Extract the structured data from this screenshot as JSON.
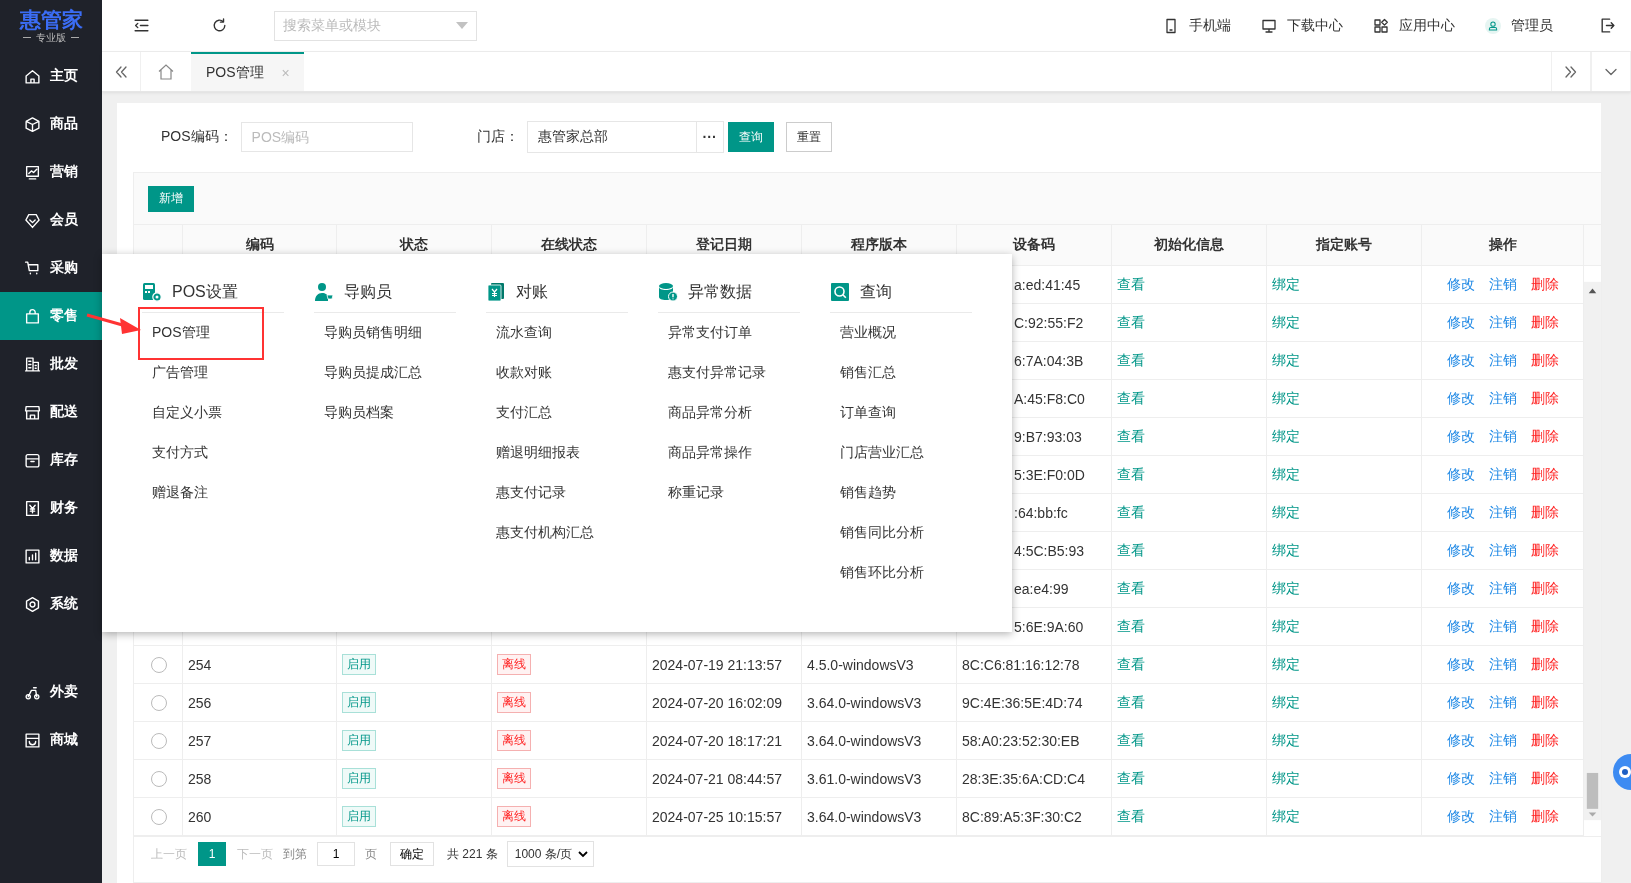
{
  "logo": {
    "name": "惠管家",
    "edition": "专业版"
  },
  "sidebar": {
    "items": [
      {
        "label": "主页",
        "selected": false
      },
      {
        "label": "商品",
        "selected": false
      },
      {
        "label": "营销",
        "selected": false
      },
      {
        "label": "会员",
        "selected": false
      },
      {
        "label": "采购",
        "selected": false
      },
      {
        "label": "零售",
        "selected": true
      },
      {
        "label": "批发",
        "selected": false
      },
      {
        "label": "配送",
        "selected": false
      },
      {
        "label": "库存",
        "selected": false
      },
      {
        "label": "财务",
        "selected": false
      },
      {
        "label": "数据",
        "selected": false
      },
      {
        "label": "系统",
        "selected": false
      }
    ],
    "extra_items": [
      {
        "label": "外卖",
        "selected": false
      },
      {
        "label": "商城",
        "selected": false
      }
    ]
  },
  "topbar": {
    "search": {
      "placeholder": "搜索菜单或模块"
    },
    "links": [
      "手机端",
      "下载中心",
      "应用中心"
    ],
    "user": "管理员"
  },
  "tabs": [
    {
      "label": "POS管理",
      "selected": true,
      "close": "×"
    }
  ],
  "filters": {
    "pos_code": {
      "label": "POS编码：",
      "placeholder": "POS编码"
    },
    "store": {
      "label": "门店：",
      "value": "惠管家总部",
      "picker": "···"
    },
    "buttons": [
      {
        "label": "查询",
        "kind": "primary"
      },
      {
        "label": "重置",
        "kind": "default"
      }
    ]
  },
  "add_button": "新增",
  "table": {
    "columns": [
      "编码",
      "状态",
      "在线状态",
      "登记日期",
      "程序版本",
      "设备码",
      "初始化信息",
      "指定账号",
      "操作"
    ],
    "rows": [
      {
        "kind": "covered",
        "device": "a:ed:41:45",
        "init": "查看",
        "account": "绑定",
        "actions": [
          "修改",
          "注销",
          "删除"
        ]
      },
      {
        "kind": "covered",
        "device": "C:92:55:F2",
        "init": "查看",
        "account": "绑定",
        "actions": [
          "修改",
          "注销",
          "删除"
        ]
      },
      {
        "kind": "covered",
        "device": "6:7A:04:3B",
        "init": "查看",
        "account": "绑定",
        "actions": [
          "修改",
          "注销",
          "删除"
        ]
      },
      {
        "kind": "covered",
        "device": "A:45:F8:C0",
        "init": "查看",
        "account": "绑定",
        "actions": [
          "修改",
          "注销",
          "删除"
        ]
      },
      {
        "kind": "covered",
        "device": "9:B7:93:03",
        "init": "查看",
        "account": "绑定",
        "actions": [
          "修改",
          "注销",
          "删除"
        ]
      },
      {
        "kind": "covered",
        "device": "5:3E:F0:0D",
        "init": "查看",
        "account": "绑定",
        "actions": [
          "修改",
          "注销",
          "删除"
        ]
      },
      {
        "kind": "covered",
        "device": ":64:bb:fc",
        "init": "查看",
        "account": "绑定",
        "actions": [
          "修改",
          "注销",
          "删除"
        ]
      },
      {
        "kind": "covered",
        "device": "4:5C:B5:93",
        "init": "查看",
        "account": "绑定",
        "actions": [
          "修改",
          "注销",
          "删除"
        ]
      },
      {
        "kind": "covered",
        "device": "ea:e4:99",
        "init": "查看",
        "account": "绑定",
        "actions": [
          "修改",
          "注销",
          "删除"
        ]
      },
      {
        "kind": "covered",
        "device": "5:6E:9A:60",
        "init": "查看",
        "account": "绑定",
        "actions": [
          "修改",
          "注销",
          "删除"
        ]
      },
      {
        "kind": "full",
        "selected": false,
        "code": "254",
        "status": "启用",
        "online": "离线",
        "date": "2024-07-19 21:13:57",
        "version": "4.5.0-windowsV3",
        "device": "8C:C6:81:16:12:78",
        "init": "查看",
        "account": "绑定",
        "actions": [
          "修改",
          "注销",
          "删除"
        ]
      },
      {
        "kind": "full",
        "selected": false,
        "code": "256",
        "status": "启用",
        "online": "离线",
        "date": "2024-07-20 16:02:09",
        "version": "3.64.0-windowsV3",
        "device": "9C:4E:36:5E:4D:74",
        "init": "查看",
        "account": "绑定",
        "actions": [
          "修改",
          "注销",
          "删除"
        ]
      },
      {
        "kind": "full",
        "selected": false,
        "code": "257",
        "status": "启用",
        "online": "离线",
        "date": "2024-07-20 18:17:21",
        "version": "3.64.0-windowsV3",
        "device": "58:A0:23:52:30:EB",
        "init": "查看",
        "account": "绑定",
        "actions": [
          "修改",
          "注销",
          "删除"
        ]
      },
      {
        "kind": "full",
        "selected": false,
        "code": "258",
        "status": "启用",
        "online": "离线",
        "date": "2024-07-21 08:44:57",
        "version": "3.61.0-windowsV3",
        "device": "28:3E:35:6A:CD:C4",
        "init": "查看",
        "account": "绑定",
        "actions": [
          "修改",
          "注销",
          "删除"
        ]
      },
      {
        "kind": "full",
        "selected": false,
        "code": "260",
        "status": "启用",
        "online": "离线",
        "date": "2024-07-25 10:15:57",
        "version": "3.64.0-windowsV3",
        "device": "8C:89:A5:3F:30:C2",
        "init": "查看",
        "account": "绑定",
        "actions": [
          "修改",
          "注销",
          "删除"
        ]
      }
    ]
  },
  "pagination": {
    "prev": {
      "label": "上一页",
      "disabled": true
    },
    "pages": [
      {
        "label": "1",
        "selected": true
      }
    ],
    "next": {
      "label": "下一页",
      "disabled": true
    },
    "goto_label": "到第",
    "goto_value": "1",
    "page_unit": "页",
    "confirm": "确定",
    "total": "共 221 条",
    "page_size": "1000 条/页"
  },
  "menu": {
    "groups": [
      {
        "title": "POS设置",
        "items": [
          {
            "label": "POS管理",
            "highlighted": true
          },
          {
            "label": "广告管理",
            "highlighted": false
          },
          {
            "label": "自定义小票",
            "highlighted": false
          },
          {
            "label": "支付方式",
            "highlighted": false
          },
          {
            "label": "赠退备注",
            "highlighted": false
          }
        ]
      },
      {
        "title": "导购员",
        "items": [
          {
            "label": "导购员销售明细",
            "highlighted": false
          },
          {
            "label": "导购员提成汇总",
            "highlighted": false
          },
          {
            "label": "导购员档案",
            "highlighted": false
          }
        ]
      },
      {
        "title": "对账",
        "items": [
          {
            "label": "流水查询",
            "highlighted": false
          },
          {
            "label": "收款对账",
            "highlighted": false
          },
          {
            "label": "支付汇总",
            "highlighted": false
          },
          {
            "label": "赠退明细报表",
            "highlighted": false
          },
          {
            "label": "惠支付记录",
            "highlighted": false
          },
          {
            "label": "惠支付机构汇总",
            "highlighted": false
          }
        ]
      },
      {
        "title": "异常数据",
        "items": [
          {
            "label": "异常支付订单",
            "highlighted": false
          },
          {
            "label": "惠支付异常记录",
            "highlighted": false
          },
          {
            "label": "商品异常分析",
            "highlighted": false
          },
          {
            "label": "商品异常操作",
            "highlighted": false
          },
          {
            "label": "称重记录",
            "highlighted": false
          }
        ]
      },
      {
        "title": "查询",
        "items": [
          {
            "label": "营业概况",
            "highlighted": false
          },
          {
            "label": "销售汇总",
            "highlighted": false
          },
          {
            "label": "订单查询",
            "highlighted": false
          },
          {
            "label": "门店营业汇总",
            "highlighted": false
          },
          {
            "label": "销售趋势",
            "highlighted": false
          },
          {
            "label": "销售同比分析",
            "highlighted": false
          },
          {
            "label": "销售环比分析",
            "highlighted": false
          }
        ]
      }
    ]
  }
}
